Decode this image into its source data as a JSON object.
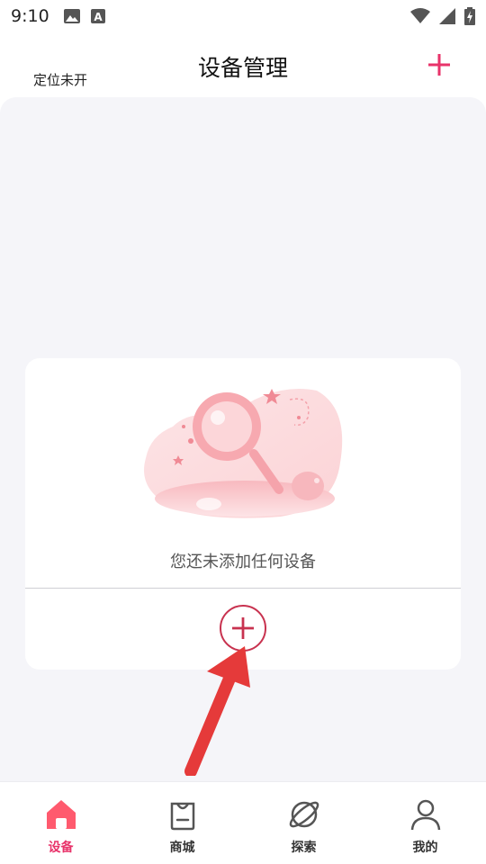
{
  "status_bar": {
    "time": "9:10",
    "icons_left": [
      "image-icon",
      "a-icon"
    ],
    "icons_right": [
      "wifi-icon",
      "signal-icon",
      "battery-icon"
    ]
  },
  "header": {
    "location_status": "定位未开",
    "title": "设备管理",
    "add_icon": "plus-icon"
  },
  "empty_state": {
    "message": "您还未添加任何设备",
    "illustration": "magnifier-illustration",
    "add_icon": "plus-circle-icon"
  },
  "bottom_nav": {
    "items": [
      {
        "label": "设备",
        "icon": "home-icon",
        "active": true
      },
      {
        "label": "商城",
        "icon": "shopping-bag-icon",
        "active": false
      },
      {
        "label": "探索",
        "icon": "planet-icon",
        "active": false
      },
      {
        "label": "我的",
        "icon": "user-icon",
        "active": false
      }
    ]
  },
  "colors": {
    "accent": "#e8336a",
    "add_button": "#c8324f",
    "background": "#f5f5f9",
    "arrow": "#e53a3a"
  }
}
